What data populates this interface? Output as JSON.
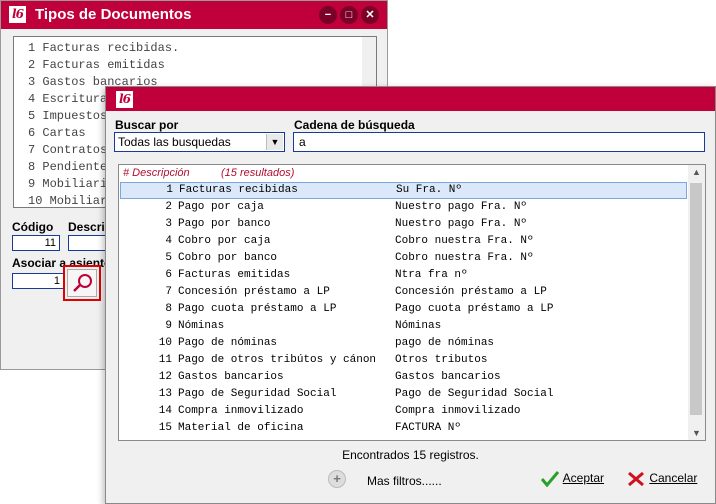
{
  "background_window": {
    "title": "Tipos de Documentos",
    "logo_text": "l6",
    "buttons": {
      "minimize": "−",
      "maximize": "□",
      "close": "✕"
    },
    "list": [
      "1 Facturas recibidas.",
      "2 Facturas emitidas",
      "3 Gastos bancarios",
      "4 Escritura",
      "5 Impuestos",
      "6 Cartas",
      "7 Contratos",
      "8 Pendiente",
      "9 Mobiliari",
      "10 Mobiliari"
    ],
    "codigo_label": "Código",
    "codigo_value": "11",
    "descripcion_label": "Descri",
    "asociar_label": "Asociar a asiento",
    "asociar_value": "1"
  },
  "dialog": {
    "logo_text": "l6",
    "buscar_por_label": "Buscar por",
    "buscar_por_value": "Todas las busquedas",
    "cadena_label": "Cadena de búsqueda",
    "cadena_value": "a",
    "grid": {
      "header_col": "# Descripción",
      "header_count": "(15 resultados)",
      "selected_index": 0,
      "rows": [
        {
          "num": "1",
          "desc": "Facturas recibidas",
          "ref": "Su Fra. Nº"
        },
        {
          "num": "2",
          "desc": "Pago por caja",
          "ref": "Nuestro pago Fra. Nº"
        },
        {
          "num": "3",
          "desc": "Pago por banco",
          "ref": "Nuestro pago Fra. Nº"
        },
        {
          "num": "4",
          "desc": "Cobro por caja",
          "ref": "Cobro nuestra Fra. Nº"
        },
        {
          "num": "5",
          "desc": "Cobro por banco",
          "ref": "Cobro nuestra Fra. Nº"
        },
        {
          "num": "6",
          "desc": "Facturas emitidas",
          "ref": "Ntra fra nº"
        },
        {
          "num": "7",
          "desc": "Concesión préstamo a LP",
          "ref": "Concesión préstamo a LP"
        },
        {
          "num": "8",
          "desc": "Pago cuota préstamo a LP",
          "ref": "Pago cuota préstamo a LP"
        },
        {
          "num": "9",
          "desc": "Nóminas",
          "ref": "Nóminas"
        },
        {
          "num": "10",
          "desc": "Pago de nóminas",
          "ref": "pago de nóminas"
        },
        {
          "num": "11",
          "desc": "Pago de otros tribútos y cánon",
          "ref": "Otros tributos"
        },
        {
          "num": "12",
          "desc": "Gastos bancarios",
          "ref": "Gastos bancarios"
        },
        {
          "num": "13",
          "desc": "Pago de Seguridad Social",
          "ref": "Pago de Seguridad Social"
        },
        {
          "num": "14",
          "desc": "Compra inmovilizado",
          "ref": "Compra inmovilizado"
        },
        {
          "num": "15",
          "desc": "Material de oficina",
          "ref": "FACTURA Nº"
        }
      ]
    },
    "status": "Encontrados 15 registros.",
    "more_filters": "Mas filtros......",
    "accept_label": "Aceptar",
    "cancel_label": "Cancelar"
  },
  "colors": {
    "brand": "#c0003a",
    "header_text": "#b01030",
    "selection": "#dbe8f9",
    "field_border": "#1a3a9a"
  }
}
